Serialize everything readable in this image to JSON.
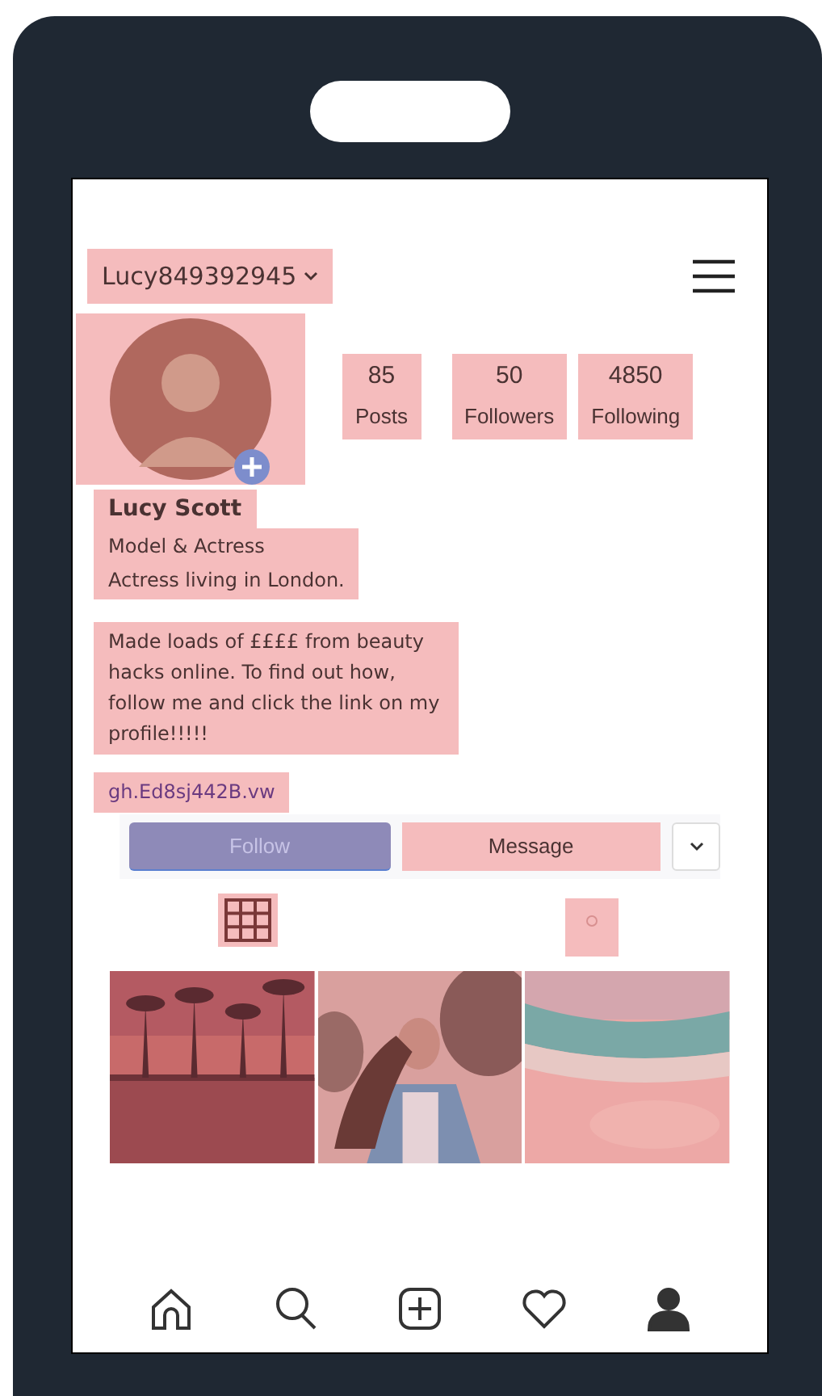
{
  "header": {
    "username": "Lucy849392945"
  },
  "stats": [
    {
      "value": "85",
      "label": "Posts"
    },
    {
      "value": "50",
      "label": "Followers"
    },
    {
      "value": "4850",
      "label": "Following"
    }
  ],
  "profile": {
    "name": "Lucy Scott",
    "lines": [
      "Model & Actress",
      "Actress living in London."
    ],
    "bio": "Made loads of ££££ from beauty hacks online.  To find out how, follow me and click the link on my profile!!!!!",
    "link": "gh.Ed8sj442B.vw"
  },
  "actions": {
    "follow": "Follow",
    "message": "Message"
  },
  "tabs": [
    {
      "kind": "grid"
    },
    {
      "kind": "tagged"
    }
  ],
  "nav": [
    {
      "kind": "home",
      "selected": false
    },
    {
      "kind": "search",
      "selected": false
    },
    {
      "kind": "add",
      "selected": false
    },
    {
      "kind": "heart",
      "selected": false
    },
    {
      "kind": "profile",
      "selected": true
    }
  ]
}
